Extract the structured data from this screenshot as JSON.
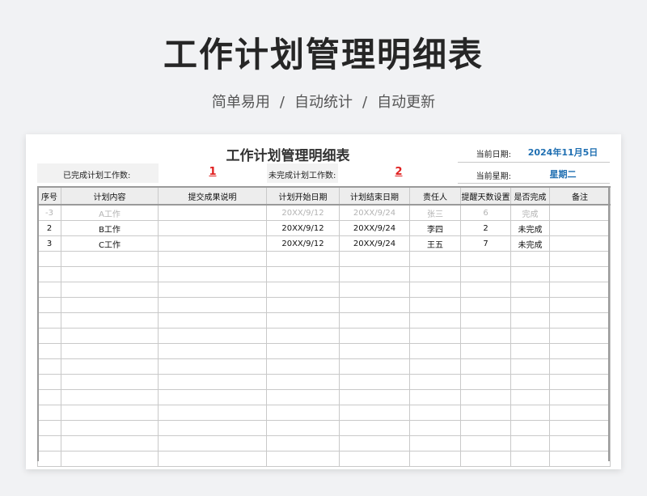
{
  "header": {
    "title": "工作计划管理明细表",
    "subtitle_items": [
      "简单易用",
      "自动统计",
      "自动更新"
    ],
    "separator": "/"
  },
  "sheet": {
    "title": "工作计划管理明细表",
    "current_date_label": "当前日期:",
    "current_date_value": "2024年11月5日",
    "current_weekday_label": "当前星期:",
    "current_weekday_value": "星期二",
    "completed_label": "已完成计划工作数:",
    "completed_value": "1",
    "uncompleted_label": "未完成计划工作数:",
    "uncompleted_value": "2"
  },
  "table": {
    "columns": [
      "序号",
      "计划内容",
      "提交成果说明",
      "计划开始日期",
      "计划结束日期",
      "责任人",
      "提醒天数设置",
      "是否完成",
      "备注"
    ],
    "rows": [
      [
        "-3",
        "A工作",
        "",
        "20XX/9/12",
        "20XX/9/24",
        "张三",
        "6",
        "完成",
        ""
      ],
      [
        "2",
        "B工作",
        "",
        "20XX/9/12",
        "20XX/9/24",
        "李四",
        "2",
        "未完成",
        ""
      ],
      [
        "3",
        "C工作",
        "",
        "20XX/9/12",
        "20XX/9/24",
        "王五",
        "7",
        "未完成",
        ""
      ]
    ],
    "muted_rows": [
      0
    ],
    "empty_row_count": 14
  },
  "colors": {
    "accent_blue": "#1f6fb2",
    "stat_red": "#e02020"
  }
}
